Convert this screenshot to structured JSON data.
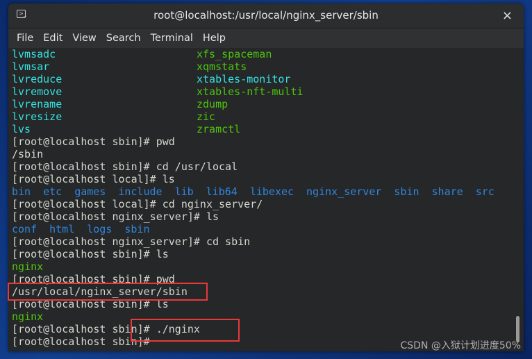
{
  "window": {
    "title": "root@localhost:/usr/local/nginx_server/sbin",
    "icon": "terminal-icon",
    "close": "×"
  },
  "menu": [
    "File",
    "Edit",
    "View",
    "Search",
    "Terminal",
    "Help"
  ],
  "colors": {
    "cyan": "#34e2e2",
    "green": "#4ec40f",
    "blue": "#2f86e0",
    "text": "#d3d7cf",
    "highlight": "#e8393b"
  },
  "terminal": {
    "lines": [
      {
        "type": "cols",
        "a": "lvmsadc",
        "ac": "cyan",
        "b": "xfs_spaceman",
        "bc": "green"
      },
      {
        "type": "cols",
        "a": "lvmsar",
        "ac": "cyan",
        "b": "xqmstats",
        "bc": "green"
      },
      {
        "type": "cols",
        "a": "lvreduce",
        "ac": "cyan",
        "b": "xtables-monitor",
        "bc": "cyan"
      },
      {
        "type": "cols",
        "a": "lvremove",
        "ac": "cyan",
        "b": "xtables-nft-multi",
        "bc": "green"
      },
      {
        "type": "cols",
        "a": "lvrename",
        "ac": "cyan",
        "b": "zdump",
        "bc": "green"
      },
      {
        "type": "cols",
        "a": "lvresize",
        "ac": "cyan",
        "b": "zic",
        "bc": "green"
      },
      {
        "type": "cols",
        "a": "lvs",
        "ac": "cyan",
        "b": "zramctl",
        "bc": "green"
      },
      {
        "type": "text",
        "text": "[root@localhost sbin]# pwd"
      },
      {
        "type": "text",
        "text": "/sbin"
      },
      {
        "type": "text",
        "text": "[root@localhost sbin]# cd /usr/local"
      },
      {
        "type": "text",
        "text": "[root@localhost local]# ls"
      },
      {
        "type": "items",
        "color": "blue",
        "items": [
          "bin",
          "etc",
          "games",
          "include",
          "lib",
          "lib64",
          "libexec",
          "nginx_server",
          "sbin",
          "share",
          "src"
        ]
      },
      {
        "type": "text",
        "text": "[root@localhost local]# cd nginx_server/"
      },
      {
        "type": "text",
        "text": "[root@localhost nginx_server]# ls"
      },
      {
        "type": "items",
        "color": "blue",
        "items": [
          "conf",
          "html",
          "logs",
          "sbin"
        ]
      },
      {
        "type": "text",
        "text": "[root@localhost nginx_server]# cd sbin"
      },
      {
        "type": "text",
        "text": "[root@localhost sbin]# ls"
      },
      {
        "type": "items",
        "color": "green",
        "items": [
          "nginx"
        ]
      },
      {
        "type": "text",
        "text": "[root@localhost sbin]# pwd"
      },
      {
        "type": "text",
        "text": "/usr/local/nginx_server/sbin"
      },
      {
        "type": "text",
        "text": "[root@localhost sbin]# ls"
      },
      {
        "type": "items",
        "color": "green",
        "items": [
          "nginx"
        ]
      },
      {
        "type": "text",
        "text": "[root@localhost sbin]# ./nginx"
      },
      {
        "type": "text",
        "text": "[root@localhost sbin]# "
      }
    ]
  },
  "watermark": "CSDN @入狱计划进度50%"
}
